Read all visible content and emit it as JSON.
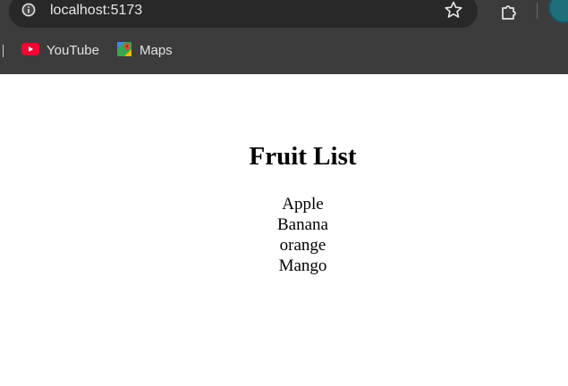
{
  "browser": {
    "url": "localhost:5173",
    "bookmarks": [
      {
        "label": "YouTube",
        "icon": "youtube-icon"
      },
      {
        "label": "Maps",
        "icon": "maps-icon"
      }
    ]
  },
  "page": {
    "title": "Fruit List",
    "fruits": [
      "Apple",
      "Banana",
      "orange",
      "Mango"
    ]
  }
}
